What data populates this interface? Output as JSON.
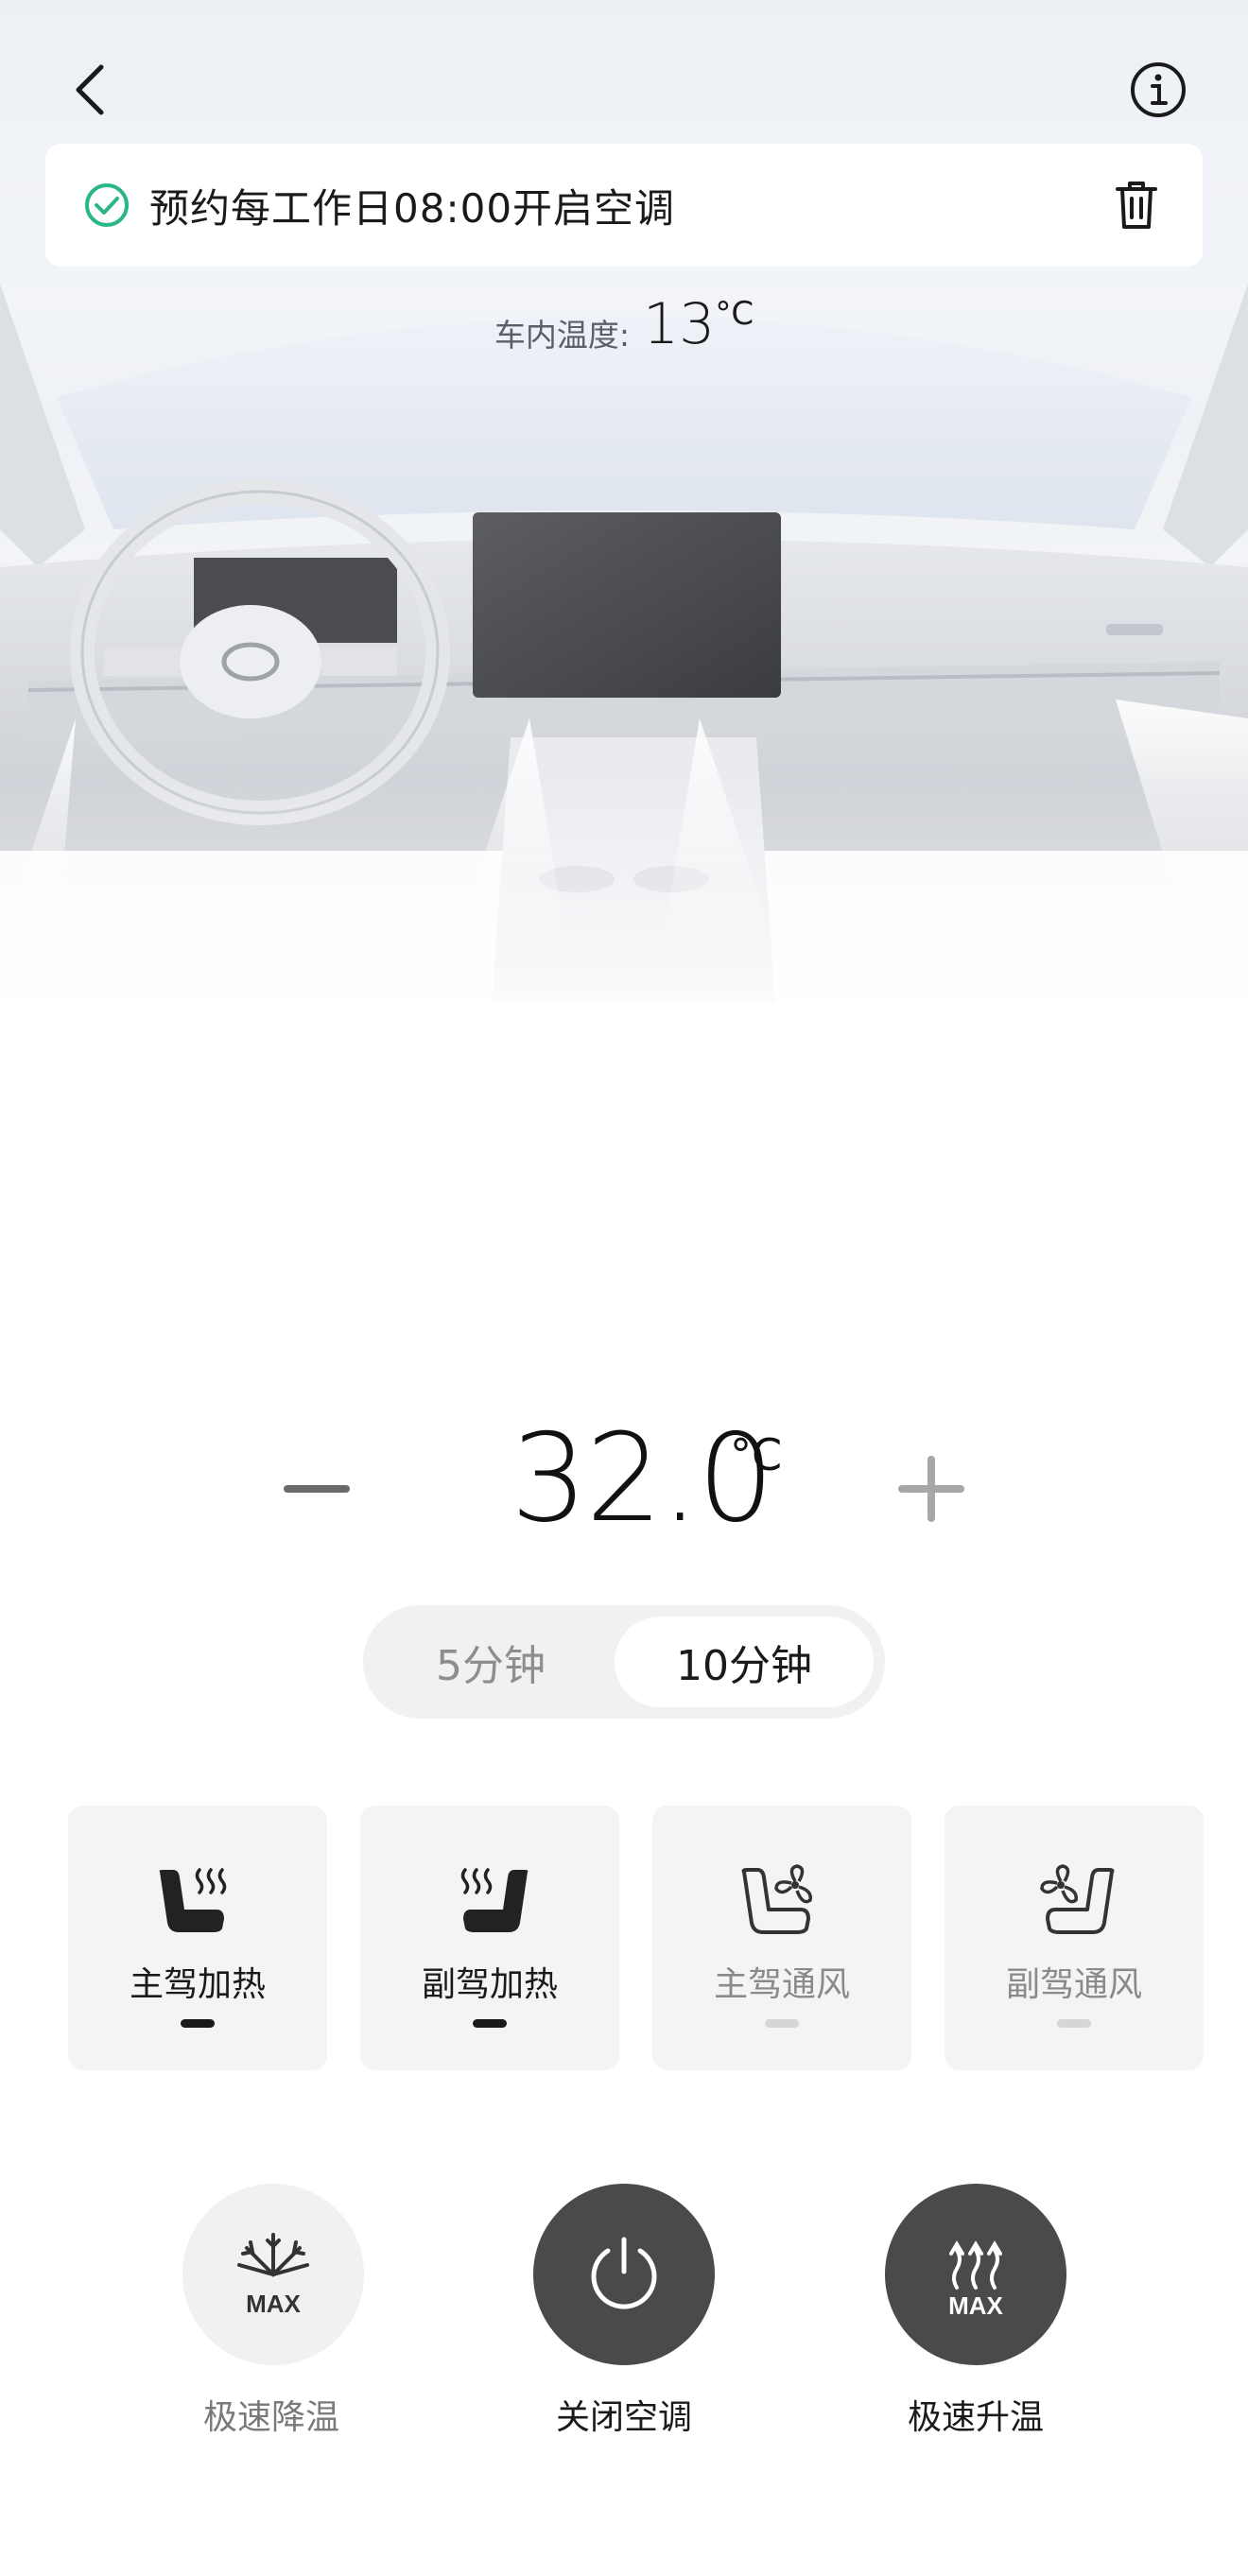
{
  "schedule": {
    "text": "预约每工作日08:00开启空调"
  },
  "cabin": {
    "label": "车内温度:",
    "value": "13",
    "unit": "°C"
  },
  "target_temp": {
    "value": "32.0",
    "unit": "°C"
  },
  "duration": {
    "options": [
      "5分钟",
      "10分钟"
    ],
    "selected": "10分钟"
  },
  "seats": [
    {
      "label": "主驾加热",
      "active": true,
      "icon": "driver-seat-heat-icon"
    },
    {
      "label": "副驾加热",
      "active": true,
      "icon": "passenger-seat-heat-icon"
    },
    {
      "label": "主驾通风",
      "active": false,
      "icon": "driver-seat-vent-icon"
    },
    {
      "label": "副驾通风",
      "active": false,
      "icon": "passenger-seat-vent-icon"
    }
  ],
  "actions": {
    "cool_max_label": "极速降温",
    "power_label": "关闭空调",
    "heat_max_label": "极速升温",
    "max_text": "MAX"
  },
  "colors": {
    "accent_green": "#2bb58a",
    "dark_button": "#4a4a4a",
    "light_button": "#f1f1f2"
  }
}
